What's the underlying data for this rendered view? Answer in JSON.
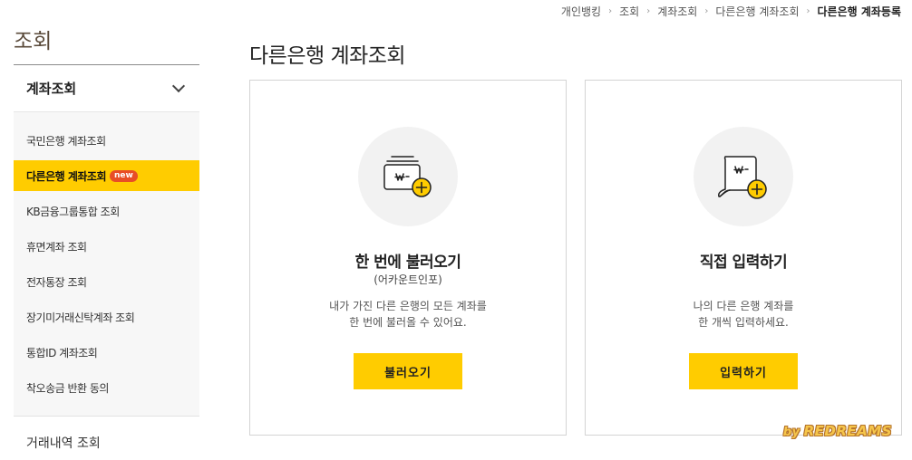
{
  "breadcrumb": [
    {
      "label": "개인뱅킹"
    },
    {
      "label": "조회"
    },
    {
      "label": "계좌조회"
    },
    {
      "label": "다른은행 계좌조회"
    },
    {
      "label": "다른은행 계좌등록"
    }
  ],
  "sidebar": {
    "title": "조회",
    "section_label": "계좌조회",
    "items": [
      {
        "label": "국민은행 계좌조회"
      },
      {
        "label": "다른은행 계좌조회",
        "badge": "new",
        "active": true
      },
      {
        "label": "KB금융그룹통합 조회"
      },
      {
        "label": "휴면계좌 조회"
      },
      {
        "label": "전자통장 조회"
      },
      {
        "label": "장기미거래신탁계좌 조회"
      },
      {
        "label": "통합ID 계좌조회"
      },
      {
        "label": "착오송금 반환 동의"
      }
    ],
    "other_label": "거래내역 조회"
  },
  "page_title": "다른은행 계좌조회",
  "cards": [
    {
      "icon": "wallet-won-add-icon",
      "title": "한 번에 불러오기",
      "subtitle": "(어카운트인포)",
      "desc_line1": "내가 가진 다른 은행의 모든 계좌를",
      "desc_line2": "한 번에 불러올 수 있어요.",
      "button": "불러오기"
    },
    {
      "icon": "scroll-won-add-icon",
      "title": "직접 입력하기",
      "desc_line1": "나의 다른 은행 계좌를",
      "desc_line2": "한 개씩 입력하세요.",
      "button": "입력하기"
    }
  ],
  "watermark": {
    "by": "by",
    "name": "REDREAMS"
  },
  "colors": {
    "accent": "#ffcc00",
    "badge": "#e84e26",
    "title_brown": "#5a4a3a"
  }
}
